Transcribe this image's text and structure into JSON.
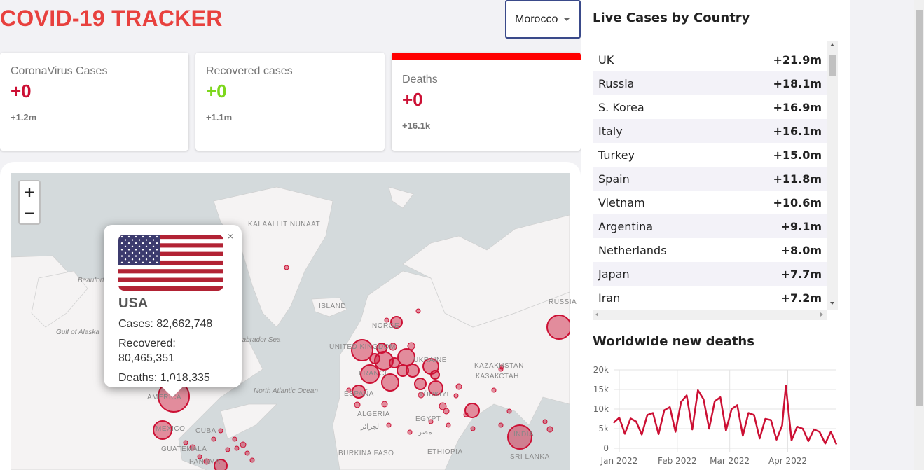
{
  "header": {
    "title": "COVID-19 TRACKER"
  },
  "country_select": {
    "value": "Morocco"
  },
  "cards": [
    {
      "title": "CoronaVirus Cases",
      "value": "+0",
      "total": "+1.2m"
    },
    {
      "title": "Recovered cases",
      "value": "+0",
      "total": "+1.1m"
    },
    {
      "title": "Deaths",
      "value": "+0",
      "total": "+16.1k"
    }
  ],
  "map": {
    "labels": [
      "KALAALLIT NUNAAT",
      "Beaufort",
      "Gulf of Alaska",
      "ISLAND",
      "NORGE",
      "UNITED KINGDOM",
      "Labrador Sea",
      "North Atlantic Ocean",
      "KAZAKHSTAN",
      "КАЗАКСТАН",
      "ALGERIA",
      "الجزائر",
      "EGYPT",
      "مصر",
      "ETHIOPIA",
      "BURKINA FASO",
      "INDIA",
      "SRI LANKA",
      "RUSSIA",
      "MEXICO",
      "CUBA",
      "PANAMA",
      "GUATEMALA",
      "AMERICA",
      "FRANCE",
      "UKRAINE",
      "TÜRKIYE",
      "ESPAÑA"
    ],
    "zoom_in": "+",
    "zoom_out": "−"
  },
  "popup": {
    "country": "USA",
    "cases": "Cases: 82,662,748",
    "recovered_label": "Recovered:",
    "recovered_value": "80,465,351",
    "deaths": "Deaths: 1,018,335",
    "close": "×"
  },
  "sidebar": {
    "live_title": "Live Cases by Country",
    "rows": [
      {
        "country": "UK",
        "cases": "+21.9m"
      },
      {
        "country": "Russia",
        "cases": "+18.1m"
      },
      {
        "country": "S. Korea",
        "cases": "+16.9m"
      },
      {
        "country": "Italy",
        "cases": "+16.1m"
      },
      {
        "country": "Turkey",
        "cases": "+15.0m"
      },
      {
        "country": "Spain",
        "cases": "+11.8m"
      },
      {
        "country": "Vietnam",
        "cases": "+10.6m"
      },
      {
        "country": "Argentina",
        "cases": "+9.1m"
      },
      {
        "country": "Netherlands",
        "cases": "+8.0m"
      },
      {
        "country": "Japan",
        "cases": "+7.7m"
      },
      {
        "country": "Iran",
        "cases": "+7.2m"
      }
    ],
    "chart_title": "Worldwide new deaths"
  },
  "chart_data": {
    "type": "line",
    "title": "Worldwide new deaths",
    "xlabel": "",
    "ylabel": "",
    "ylim": [
      0,
      20000
    ],
    "yticks": [
      "0",
      "5k",
      "10k",
      "15k",
      "20k"
    ],
    "xticks": [
      "Jan 2022",
      "Feb 2022",
      "Mar 2022",
      "Apr 2022"
    ],
    "color": "#cc1034",
    "grid": true,
    "series": [
      {
        "x": [
          "2021-12-29",
          "2022-01-01",
          "2022-01-04",
          "2022-01-07",
          "2022-01-10",
          "2022-01-13",
          "2022-01-16",
          "2022-01-19",
          "2022-01-22",
          "2022-01-25",
          "2022-01-28",
          "2022-01-31",
          "2022-02-03",
          "2022-02-06",
          "2022-02-09",
          "2022-02-12",
          "2022-02-15",
          "2022-02-18",
          "2022-02-21",
          "2022-02-24",
          "2022-02-27",
          "2022-03-02",
          "2022-03-05",
          "2022-03-08",
          "2022-03-11",
          "2022-03-14",
          "2022-03-17",
          "2022-03-20",
          "2022-03-23",
          "2022-03-26",
          "2022-03-29",
          "2022-03-31",
          "2022-04-03",
          "2022-04-06",
          "2022-04-09",
          "2022-04-12",
          "2022-04-15",
          "2022-04-18",
          "2022-04-21",
          "2022-04-24",
          "2022-04-27"
        ],
        "values": [
          6500,
          7800,
          3700,
          7600,
          6800,
          3500,
          8500,
          9000,
          3600,
          9700,
          10500,
          4200,
          11800,
          13500,
          4800,
          14800,
          12500,
          5000,
          12000,
          13000,
          4500,
          10000,
          11000,
          3200,
          9000,
          8500,
          2500,
          7500,
          7200,
          2200,
          5800,
          16000,
          2000,
          5500,
          5000,
          1800,
          4800,
          4200,
          1200,
          4200,
          1000
        ]
      }
    ]
  }
}
